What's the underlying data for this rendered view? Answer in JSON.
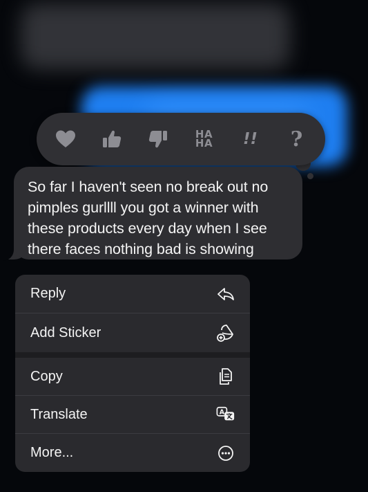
{
  "tapbacks": [
    {
      "name": "heart",
      "label": ""
    },
    {
      "name": "thumbs-up",
      "label": ""
    },
    {
      "name": "thumbs-down",
      "label": ""
    },
    {
      "name": "haha",
      "label_top": "HA",
      "label_bottom": "HA"
    },
    {
      "name": "exclamation",
      "label": "!!"
    },
    {
      "name": "question",
      "label": "?"
    }
  ],
  "message": {
    "line1": "So far I haven't seen no break out no",
    "line2": "pimples gurllll you got a winner with",
    "line3": "these products every day when I see",
    "line4": "there faces nothing bad is showing"
  },
  "menu": {
    "reply_label": "Reply",
    "add_sticker_label": "Add Sticker",
    "copy_label": "Copy",
    "translate_label": "Translate",
    "more_label": "More..."
  },
  "colors": {
    "background": "#05070b",
    "bubble": "#2e2e32",
    "menu": "#2a2a2e",
    "sent_bubble_blurred": "#1e7ef0",
    "icon_gray": "#8d8d93"
  }
}
